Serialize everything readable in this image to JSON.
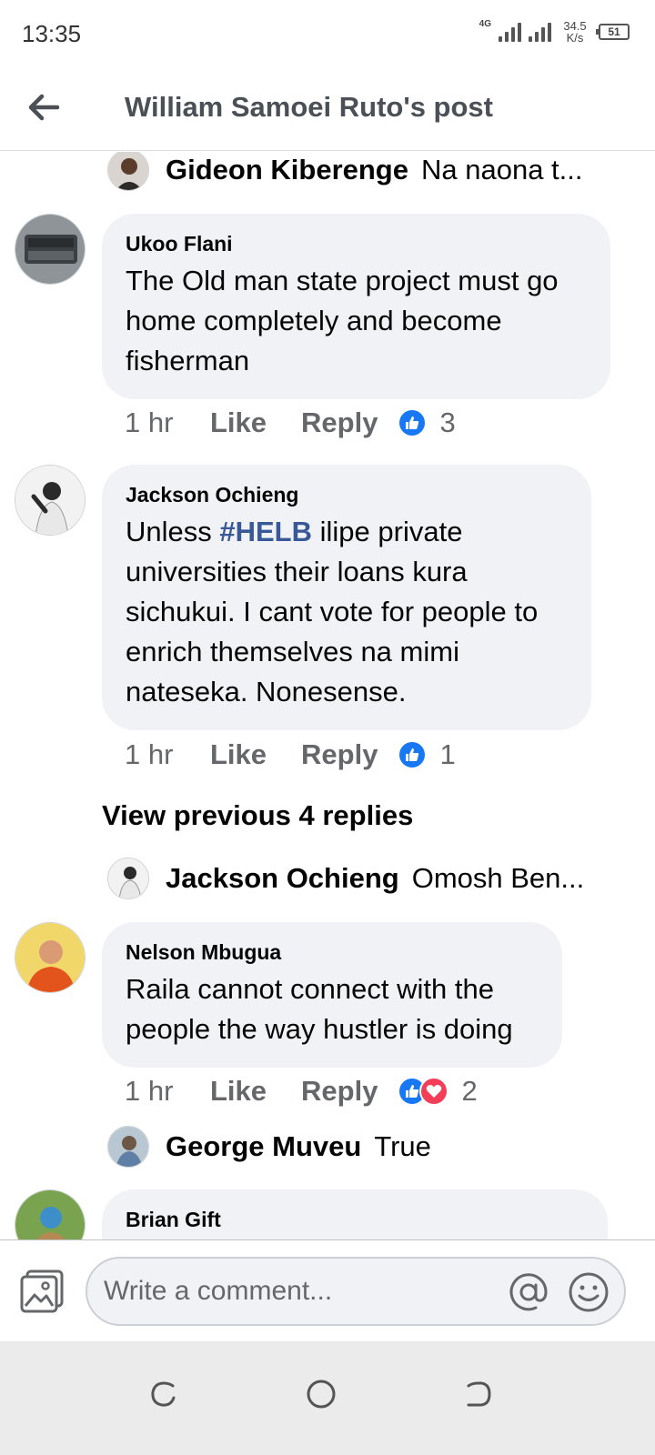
{
  "status_bar": {
    "time": "13:35",
    "network": "4G",
    "speed_value": "34.5",
    "speed_unit": "K/s",
    "battery": "51"
  },
  "header": {
    "title": "William Samoei Ruto's post"
  },
  "feed": {
    "reply_previews": [
      {
        "name": "Gideon Kiberenge",
        "text": "Na naona t..."
      },
      {
        "name": "Jackson Ochieng",
        "text": "Omosh Ben..."
      },
      {
        "name": "George Muveu",
        "text": "True"
      }
    ],
    "comments": [
      {
        "author": "Ukoo Flani",
        "text": "The Old man state project must go home completely and become fisherman",
        "time": "1 hr",
        "like_label": "Like",
        "reply_label": "Reply",
        "reaction_count": "3"
      },
      {
        "author": "Jackson Ochieng",
        "hashtag": "#HELB",
        "text_before": "Unless ",
        "text_after": " ilipe private universities their loans kura sichukui. I cant vote for people to enrich themselves na mimi nateseka. Nonesense.",
        "time": "1 hr",
        "like_label": "Like",
        "reply_label": "Reply",
        "reaction_count": "1"
      },
      {
        "author": "Nelson Mbugua",
        "text": "Raila cannot connect with the people the way hustler is doing",
        "time": "1 hr",
        "like_label": "Like",
        "reply_label": "Reply",
        "reaction_count": "2"
      },
      {
        "author": "Brian Gift"
      }
    ],
    "view_previous": "View previous 4 replies"
  },
  "composer": {
    "placeholder": "Write a comment..."
  },
  "icons": {
    "back": "arrow-left-icon",
    "photo": "photo-icon",
    "mention": "at-sign-icon",
    "emoji": "smiley-icon",
    "like_reaction": "thumbs-up-icon",
    "love_reaction": "heart-icon"
  },
  "colors": {
    "accent": "#1877f2",
    "love": "#f33e58",
    "bubble": "#f0f2f5",
    "hashtag": "#385898",
    "secondary_text": "#65676b"
  }
}
